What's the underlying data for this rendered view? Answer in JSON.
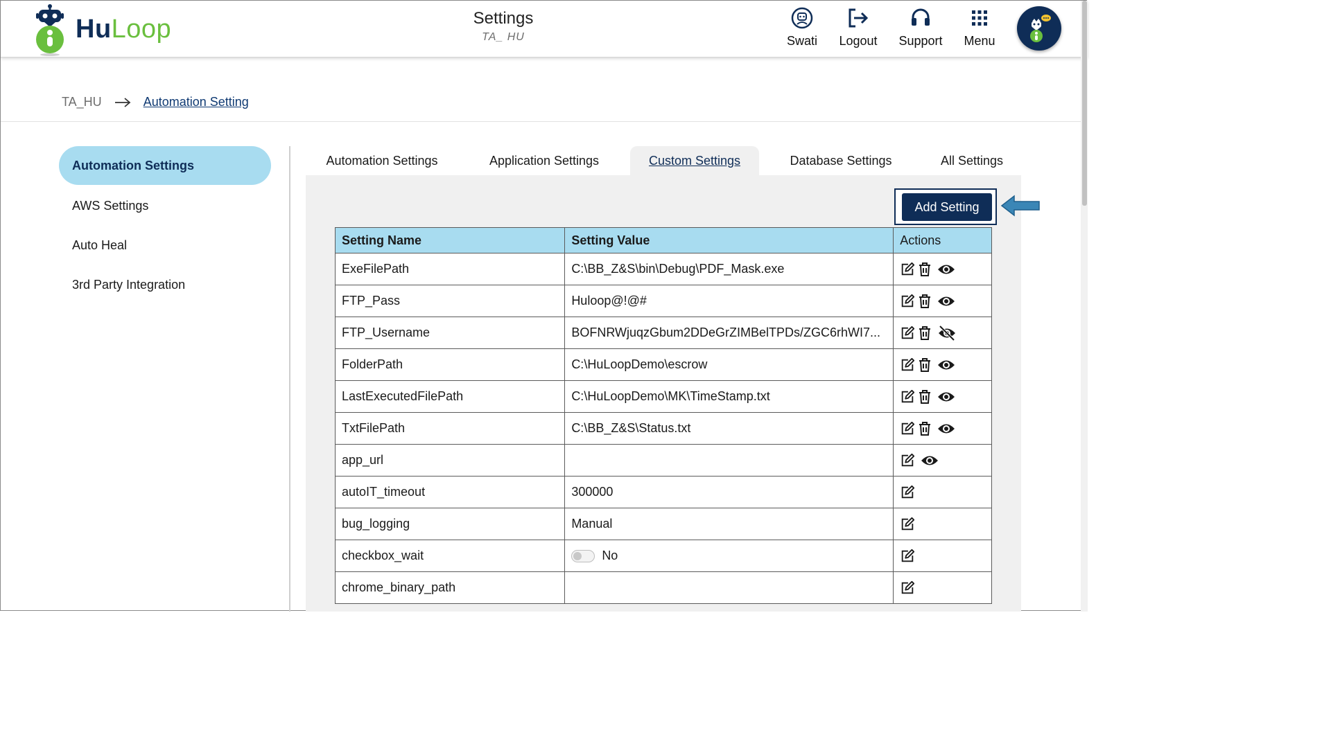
{
  "header": {
    "logo": {
      "part1": "Hu",
      "part2": "Loop"
    },
    "title": "Settings",
    "subtitle": "TA_ HU",
    "nav": [
      {
        "label": "Swati",
        "icon": "user-icon"
      },
      {
        "label": "Logout",
        "icon": "logout-icon"
      },
      {
        "label": "Support",
        "icon": "headset-icon"
      },
      {
        "label": "Menu",
        "icon": "grid-menu-icon"
      }
    ]
  },
  "breadcrumb": {
    "root": "TA_HU",
    "current": "Automation Setting"
  },
  "sidebar": {
    "items": [
      {
        "label": "Automation Settings",
        "active": true
      },
      {
        "label": "AWS Settings"
      },
      {
        "label": "Auto Heal"
      },
      {
        "label": "3rd Party Integration"
      }
    ]
  },
  "tabs": [
    {
      "label": "Automation Settings"
    },
    {
      "label": "Application Settings"
    },
    {
      "label": "Custom Settings",
      "active": true
    },
    {
      "label": "Database Settings"
    },
    {
      "label": "All Settings"
    }
  ],
  "add_button": {
    "label": "Add Setting"
  },
  "table": {
    "headers": [
      "Setting Name",
      "Setting Value",
      "Actions"
    ],
    "rows": [
      {
        "name": "ExeFilePath",
        "value": "C:\\BB_Z&S\\bin\\Debug\\PDF_Mask.exe",
        "actions": [
          "edit",
          "delete",
          "view"
        ]
      },
      {
        "name": "FTP_Pass",
        "value": "Huloop@!@#",
        "actions": [
          "edit",
          "delete",
          "view"
        ]
      },
      {
        "name": "FTP_Username",
        "value": "BOFNRWjuqzGbum2DDeGrZIMBelTPDs/ZGC6rhWI7...",
        "actions": [
          "edit",
          "delete",
          "hide"
        ]
      },
      {
        "name": "FolderPath",
        "value": "C:\\HuLoopDemo\\escrow",
        "actions": [
          "edit",
          "delete",
          "view"
        ]
      },
      {
        "name": "LastExecutedFilePath",
        "value": "C:\\HuLoopDemo\\MK\\TimeStamp.txt",
        "actions": [
          "edit",
          "delete",
          "view"
        ]
      },
      {
        "name": "TxtFilePath",
        "value": "C:\\BB_Z&S\\Status.txt",
        "actions": [
          "edit",
          "delete",
          "view"
        ]
      },
      {
        "name": "app_url",
        "value": "",
        "actions": [
          "edit",
          "view"
        ]
      },
      {
        "name": "autoIT_timeout",
        "value": "300000",
        "actions": [
          "edit"
        ]
      },
      {
        "name": "bug_logging",
        "value": "Manual",
        "actions": [
          "edit"
        ]
      },
      {
        "name": "checkbox_wait",
        "value": "No",
        "toggle": true,
        "actions": [
          "edit"
        ]
      },
      {
        "name": "chrome_binary_path",
        "value": "",
        "actions": [
          "edit"
        ]
      }
    ]
  },
  "colors": {
    "brand_navy": "#0f2d57",
    "brand_green": "#6abf3e",
    "accent_light_blue": "#a8dcf0",
    "callout_arrow": "#3a86b6"
  }
}
